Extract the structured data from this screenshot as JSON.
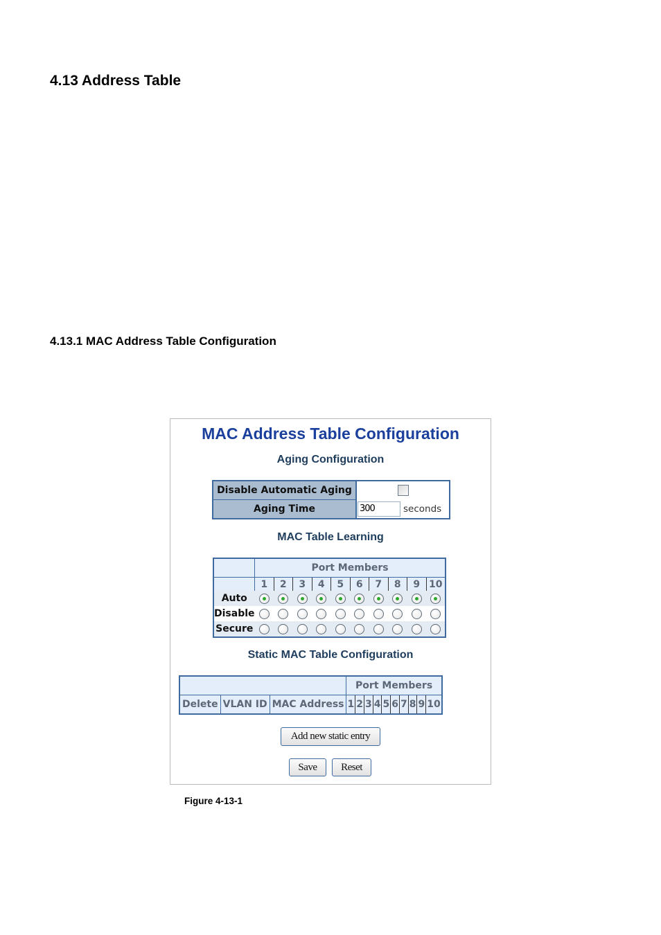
{
  "document": {
    "section_heading": "4.13 Address Table",
    "subsection_heading": "4.13.1 MAC Address Table Configuration",
    "figure_caption": "Figure 4-13-1"
  },
  "panel": {
    "title": "MAC Address Table Configuration",
    "aging": {
      "heading": "Aging Configuration",
      "disable_label": "Disable Automatic Aging",
      "disable_checked": false,
      "aging_time_label": "Aging Time",
      "aging_time_value": "300",
      "aging_time_unit": "seconds"
    },
    "learning": {
      "heading": "MAC Table Learning",
      "port_members_label": "Port Members",
      "ports": [
        "1",
        "2",
        "3",
        "4",
        "5",
        "6",
        "7",
        "8",
        "9",
        "10"
      ],
      "modes": [
        {
          "label": "Auto",
          "selected": [
            true,
            true,
            true,
            true,
            true,
            true,
            true,
            true,
            true,
            true
          ]
        },
        {
          "label": "Disable",
          "selected": [
            false,
            false,
            false,
            false,
            false,
            false,
            false,
            false,
            false,
            false
          ]
        },
        {
          "label": "Secure",
          "selected": [
            false,
            false,
            false,
            false,
            false,
            false,
            false,
            false,
            false,
            false
          ]
        }
      ]
    },
    "static": {
      "heading": "Static MAC Table Configuration",
      "port_members_label": "Port Members",
      "columns": [
        "Delete",
        "VLAN ID",
        "MAC Address"
      ],
      "ports": [
        "1",
        "2",
        "3",
        "4",
        "5",
        "6",
        "7",
        "8",
        "9",
        "10"
      ]
    },
    "buttons": {
      "add_entry": "Add new static entry",
      "save": "Save",
      "reset": "Reset"
    }
  },
  "colors": {
    "title_blue": "#1a3f9c",
    "table_border": "#3f6aa0",
    "label_bg": "#a9bcd0",
    "header_bg": "#e4eefa",
    "radio_selected": "#2ea82e"
  }
}
